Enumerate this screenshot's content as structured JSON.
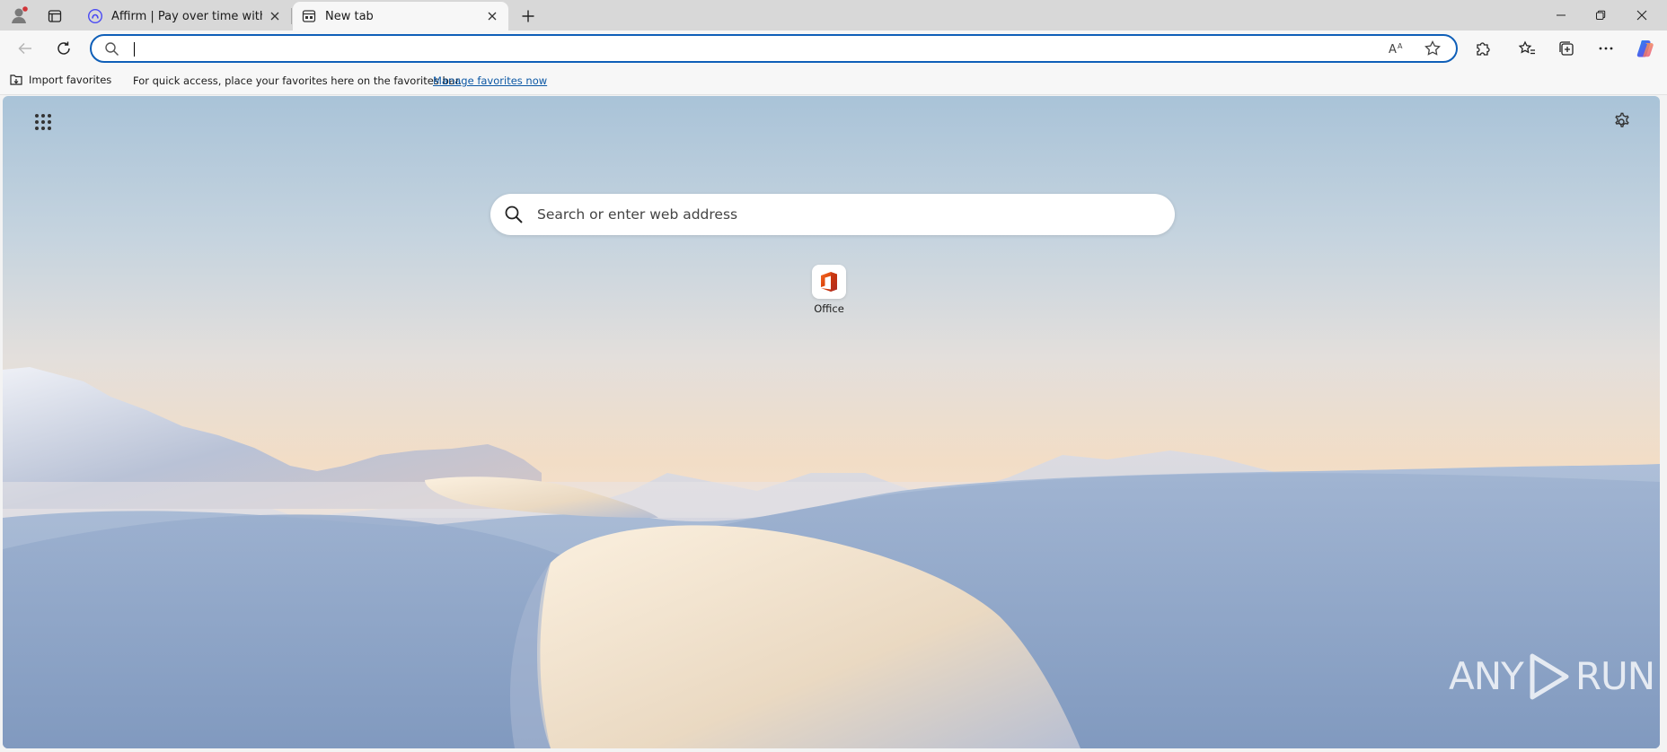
{
  "tabs": [
    {
      "title": "Affirm | Pay over time with flexible",
      "active": false
    },
    {
      "title": "New tab",
      "active": true
    }
  ],
  "address_bar": {
    "value": ""
  },
  "favorites_bar": {
    "import_label": "Import favorites",
    "hint": "For quick access, place your favorites here on the favorites bar.",
    "manage_link": "Manage favorites now"
  },
  "new_tab_page": {
    "search_placeholder": "Search or enter web address",
    "quick_links": [
      {
        "label": "Office",
        "icon": "office-icon"
      }
    ]
  },
  "watermark": {
    "left": "ANY",
    "right": "RUN"
  },
  "colors": {
    "accent": "#0f5fb8",
    "link": "#0b57a4"
  }
}
